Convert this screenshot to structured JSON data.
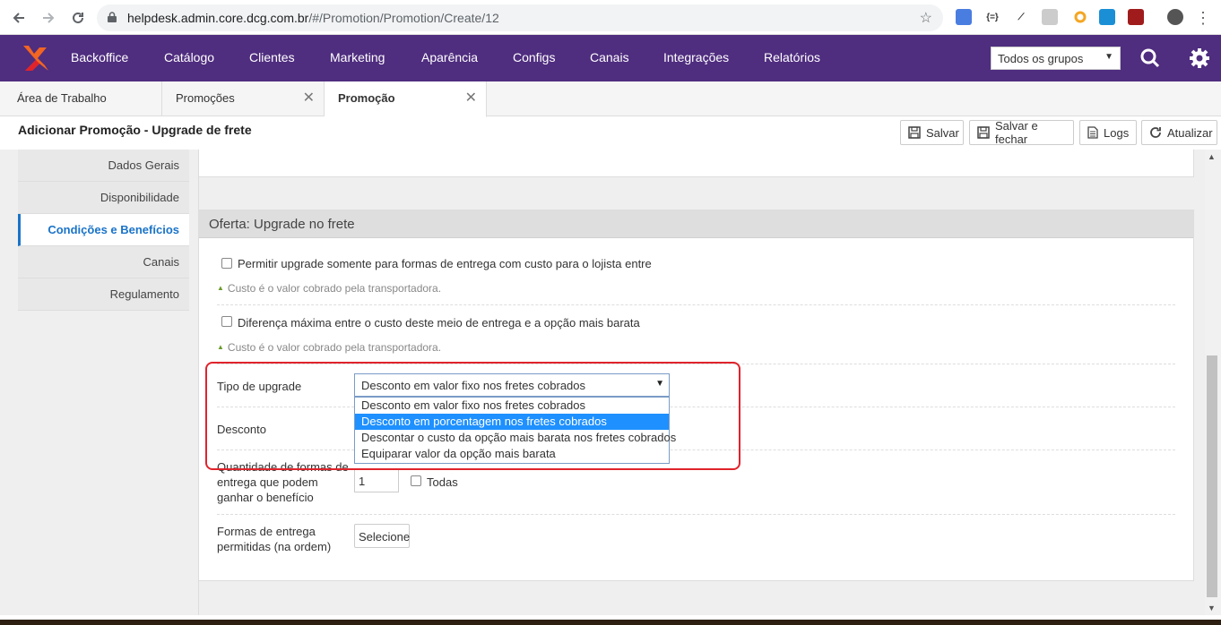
{
  "browser": {
    "url_host": "helpdesk.admin.core.dcg.com.br",
    "url_path": "/#/Promotion/Promotion/Create/12"
  },
  "nav": {
    "items": [
      "Backoffice",
      "Catálogo",
      "Clientes",
      "Marketing",
      "Aparência",
      "Configs",
      "Canais",
      "Integrações",
      "Relatórios"
    ],
    "group_select": "Todos os grupos"
  },
  "tabs": [
    "Área de Trabalho",
    "Promoções",
    "Promoção"
  ],
  "page": {
    "title": "Adicionar Promoção - Upgrade de frete",
    "buttons": {
      "save": "Salvar",
      "save_close": "Salvar e fechar",
      "logs": "Logs",
      "refresh": "Atualizar"
    }
  },
  "sidebar": {
    "items": [
      "Dados Gerais",
      "Disponibilidade",
      "Condições e Benefícios",
      "Canais",
      "Regulamento"
    ]
  },
  "offer": {
    "header": "Oferta: Upgrade no frete",
    "check1": "Permitir upgrade somente para formas de entrega com custo para o lojista entre",
    "hint1": "Custo é o valor cobrado pela transportadora.",
    "check2": "Diferença máxima entre o custo deste meio de entrega e a opção mais barata",
    "hint2": "Custo é o valor cobrado pela transportadora.",
    "upgrade_type_label": "Tipo de upgrade",
    "upgrade_type_value": "Desconto em valor fixo nos fretes cobrados",
    "upgrade_options": [
      "Desconto em valor fixo nos fretes cobrados",
      "Desconto em porcentagem nos fretes cobrados",
      "Descontar o custo da opção mais barata nos fretes cobrados",
      "Equiparar valor da opção mais barata"
    ],
    "discount_label": "Desconto",
    "qty_label_1": "Quantidade de formas de",
    "qty_label_2": "entrega que podem",
    "qty_label_3": "ganhar o benefício",
    "qty_value": "1",
    "all_label": "Todas",
    "methods_label_1": "Formas de entrega",
    "methods_label_2": "permitidas (na ordem)",
    "select_button": "Selecione"
  },
  "colors": {
    "nav_bg": "#4f2d7f",
    "accent": "#1a73c8",
    "highlight": "#1e90ff",
    "annotation": "#e0232b"
  }
}
